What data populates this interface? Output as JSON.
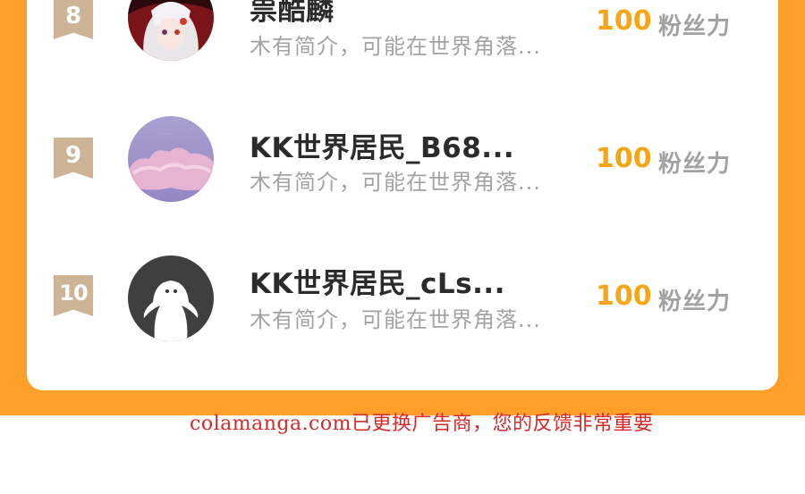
{
  "ranking": [
    {
      "rank": "8",
      "name": "祟酷麟",
      "bio": "木有简介，可能在世界角落...",
      "score": "100",
      "unit": "粉丝力",
      "avatar_icon": "anime-girl-avatar-icon"
    },
    {
      "rank": "9",
      "name": "KK世界居民_B68...",
      "bio": "木有简介，可能在世界角落...",
      "score": "100",
      "unit": "粉丝力",
      "avatar_icon": "purple-cloud-avatar-icon"
    },
    {
      "rank": "10",
      "name": "KK世界居民_cLs...",
      "bio": "木有简介，可能在世界角落...",
      "score": "100",
      "unit": "粉丝力",
      "avatar_icon": "default-ghost-avatar-icon"
    }
  ],
  "footer": {
    "notice": "colamanga.com已更换广告商，您的反馈非常重要"
  },
  "colors": {
    "frame_orange": "#fd9f28",
    "rank_badge": "#cdb497",
    "score_gold": "#f6a615",
    "notice_red": "#d42a2a"
  }
}
